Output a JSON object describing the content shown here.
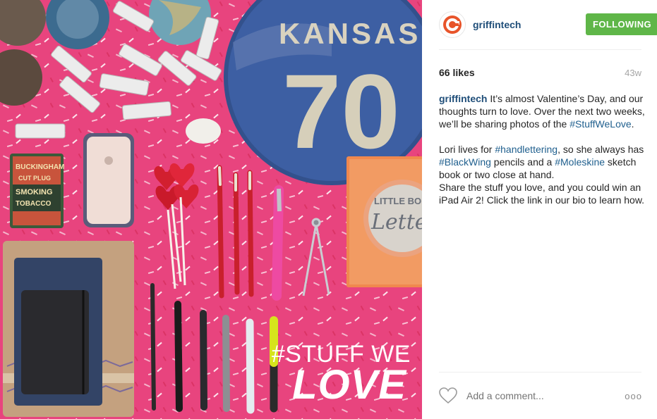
{
  "photo": {
    "hashtag_line": "#STUFF WE",
    "love_line": "LOVE",
    "road_sign_text": "KANSAS",
    "road_sign_number": "70",
    "book_title_a": "LITTLE BO",
    "book_title_b": "Letter",
    "tin_text_a": "BUCKINGHAM",
    "tin_text_b": "CUT PLUG",
    "tin_text_c": "SMOKING",
    "tin_text_d": "TOBACCO"
  },
  "post": {
    "username": "griffintech",
    "follow_label": "FOLLOWING",
    "likes": "66 likes",
    "age": "43w",
    "caption": {
      "user": "griffintech",
      "p1_text": " It’s almost Valentine’s Day, and our thoughts turn to love. Over the next two weeks, we’ll be sharing photos of the ",
      "p1_tag": "#StuffWeLove",
      "p1_end": ".",
      "p2_a": "Lori lives for ",
      "p2_tag1": "#handlettering",
      "p2_b": ", so she always has ",
      "p2_tag2": "#BlackWing",
      "p2_c": " pencils and a ",
      "p2_tag3": "#Moleskine",
      "p2_d": " sketch book or two close at hand.",
      "p2_e": "Share the stuff you love, and you could win an iPad Air 2! Click the link in our bio to learn how."
    },
    "comment_placeholder": "Add a comment...",
    "more_label": "ooo"
  },
  "colors": {
    "accent_follow": "#5fb648",
    "username": "#1f4e79",
    "hashtag": "#1f5f8e",
    "photo_background": "#e8447e",
    "logo_orange": "#e8542a"
  },
  "icons": [
    "griffin-logo-icon",
    "heart-icon",
    "more-options-icon"
  ]
}
